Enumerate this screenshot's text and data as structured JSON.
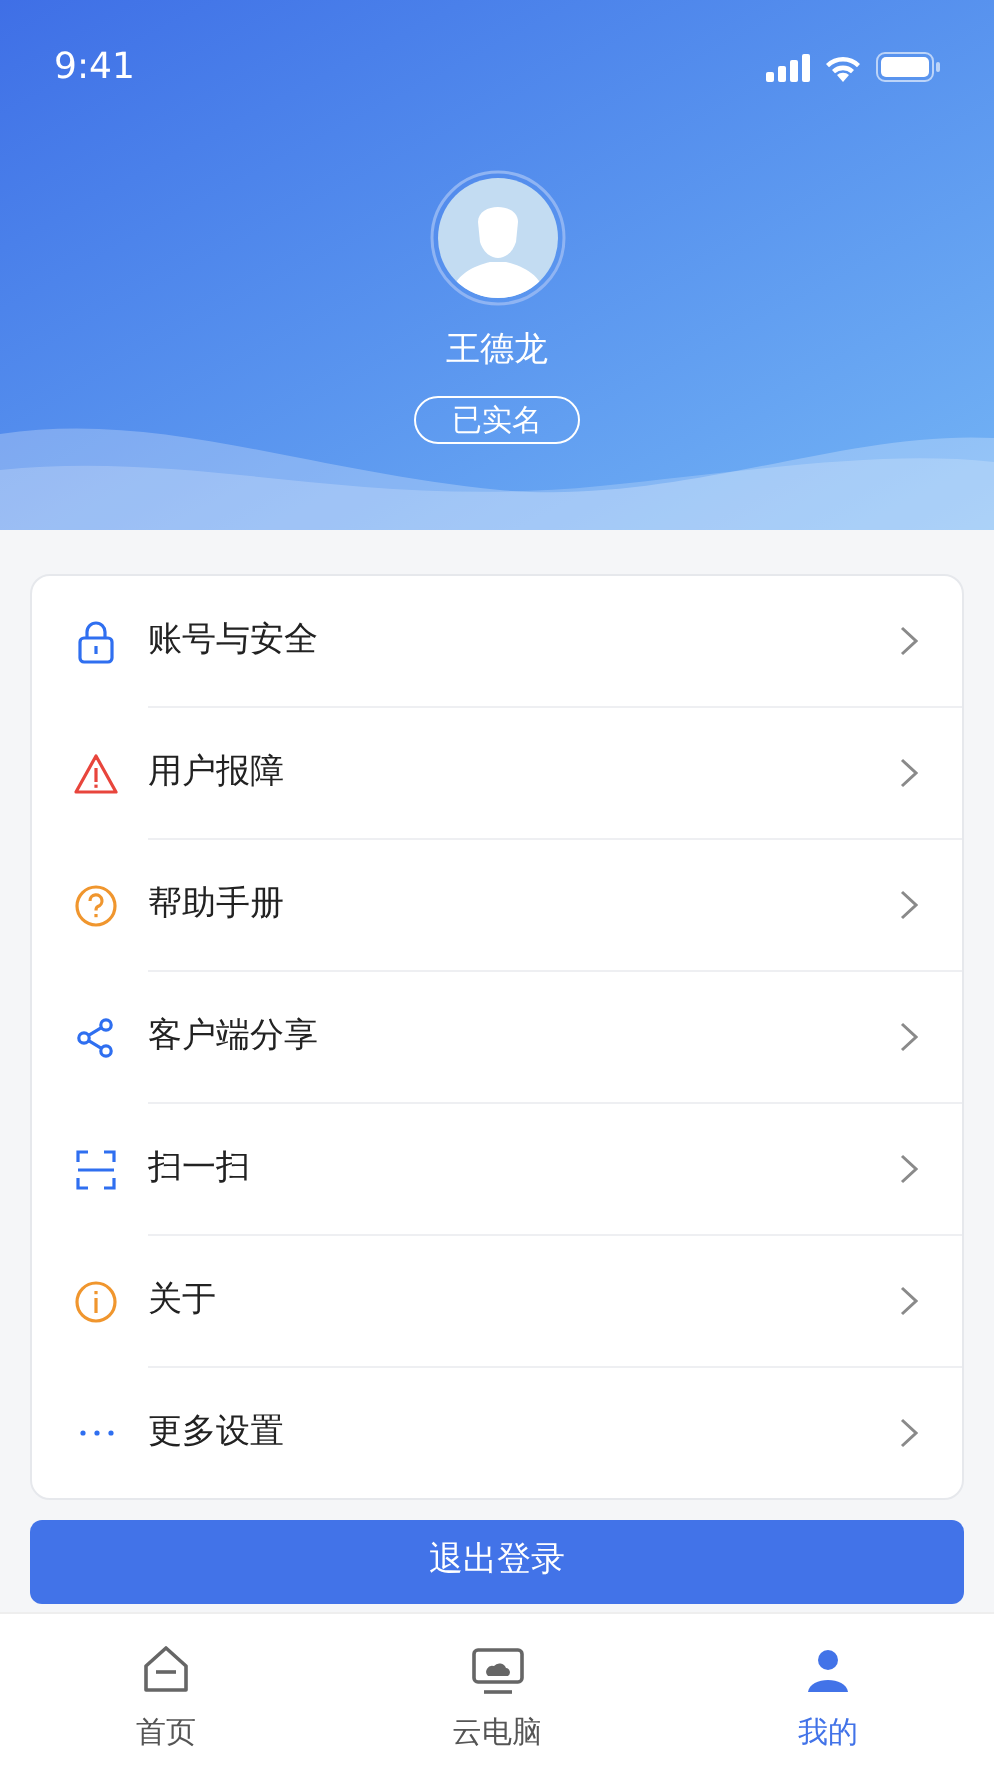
{
  "status_bar": {
    "time": "9:41"
  },
  "profile": {
    "name": "王德龙",
    "badge": "已实名"
  },
  "menu": [
    {
      "label": "账号与安全",
      "kind": "lock"
    },
    {
      "label": "用户报障",
      "kind": "warning"
    },
    {
      "label": "帮助手册",
      "kind": "help"
    },
    {
      "label": "客户端分享",
      "kind": "share"
    },
    {
      "label": "扫一扫",
      "kind": "scan"
    },
    {
      "label": "关于",
      "kind": "info"
    },
    {
      "label": "更多设置",
      "kind": "more"
    }
  ],
  "logout_button": "退出登录",
  "tabs": [
    {
      "label": "首页",
      "kind": "home",
      "selected": false
    },
    {
      "label": "云电脑",
      "kind": "monitor",
      "selected": false
    },
    {
      "label": "我的",
      "kind": "person",
      "selected": true
    }
  ]
}
